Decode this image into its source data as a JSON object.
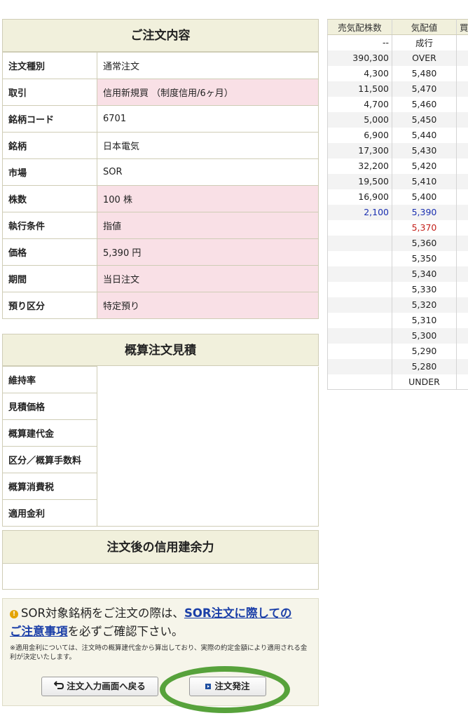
{
  "order": {
    "title": "ご注文内容",
    "rows": [
      {
        "label": "注文種別",
        "value": "通常注文"
      },
      {
        "label": "取引",
        "value": "信用新規買 （制度信用/6ヶ月）"
      },
      {
        "label": "銘柄コード",
        "value": "6701"
      },
      {
        "label": "銘柄",
        "value": "日本電気"
      },
      {
        "label": "市場",
        "value": "SOR"
      },
      {
        "label": "株数",
        "value": "100 株"
      },
      {
        "label": "執行条件",
        "value": "指値"
      },
      {
        "label": "価格",
        "value": "5,390 円"
      },
      {
        "label": "期間",
        "value": "当日注文"
      },
      {
        "label": "預り区分",
        "value": "特定預り"
      }
    ]
  },
  "estimate": {
    "title": "概算注文見積",
    "rows": [
      "維持率",
      "見積価格",
      "概算建代金",
      "区分／概算手数料",
      "概算消費税",
      "適用金利"
    ]
  },
  "margin": {
    "title": "注文後の信用建余力"
  },
  "book": {
    "headers": [
      "売気配株数",
      "気配値",
      "買"
    ],
    "rows": [
      {
        "qty": "--",
        "price": "成行"
      },
      {
        "qty": "390,300",
        "price": "OVER"
      },
      {
        "qty": "4,300",
        "price": "5,480"
      },
      {
        "qty": "11,500",
        "price": "5,470"
      },
      {
        "qty": "4,700",
        "price": "5,460"
      },
      {
        "qty": "5,000",
        "price": "5,450"
      },
      {
        "qty": "6,900",
        "price": "5,440"
      },
      {
        "qty": "17,300",
        "price": "5,430"
      },
      {
        "qty": "32,200",
        "price": "5,420"
      },
      {
        "qty": "19,500",
        "price": "5,410"
      },
      {
        "qty": "16,900",
        "price": "5,400"
      },
      {
        "qty": "2,100",
        "price": "5,390"
      },
      {
        "qty": "",
        "price": "5,370"
      },
      {
        "qty": "",
        "price": "5,360"
      },
      {
        "qty": "",
        "price": "5,350"
      },
      {
        "qty": "",
        "price": "5,340"
      },
      {
        "qty": "",
        "price": "5,330"
      },
      {
        "qty": "",
        "price": "5,320"
      },
      {
        "qty": "",
        "price": "5,310"
      },
      {
        "qty": "",
        "price": "5,300"
      },
      {
        "qty": "",
        "price": "5,290"
      },
      {
        "qty": "",
        "price": "5,280"
      },
      {
        "qty": "",
        "price": "UNDER"
      }
    ]
  },
  "notice": {
    "text1": "SOR対象銘柄をご注文の際は、",
    "link": "SOR注文に際しての",
    "link2": "ご注意事項",
    "text2": "を必ずご確認下さい。",
    "small": "※適用金利については、注文時の概算建代金から算出しており、実際の約定金額により適用される金利が決定いたします。"
  },
  "buttons": {
    "back": "注文入力画面へ戻る",
    "submit": "注文発注"
  },
  "colors": {
    "header_bg": "#f1f0dc",
    "highlight_pink": "#f9e0e6",
    "link_blue": "#1b3fa8",
    "circle_green": "#57a23b"
  }
}
